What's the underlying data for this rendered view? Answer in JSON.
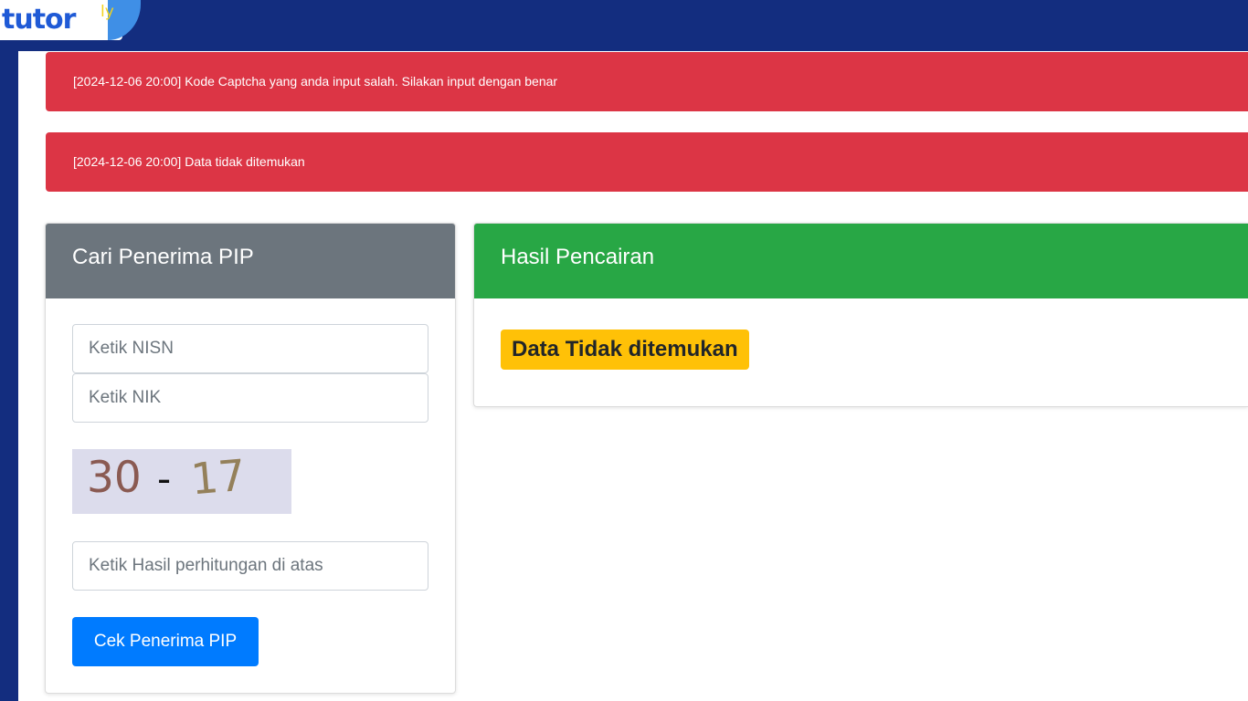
{
  "brand": {
    "logo_text": "tutor",
    "logo_sup": "ly",
    "accent": "#132d7f"
  },
  "alerts": [
    {
      "text": "[2024-12-06 20:00] Kode Captcha yang anda input salah. Silakan input dengan benar",
      "color": "#dc3545"
    },
    {
      "text": "[2024-12-06 20:00] Data tidak ditemukan",
      "color": "#dc3545"
    }
  ],
  "search": {
    "title": "Cari Penerima PIP",
    "nisn_placeholder": "Ketik NISN",
    "nisn_value": "",
    "nik_placeholder": "Ketik NIK",
    "nik_value": "",
    "captcha_a": "30",
    "captcha_op": "-",
    "captcha_b": "17",
    "answer_placeholder": "Ketik Hasil perhitungan di atas",
    "answer_value": "",
    "submit_label": "Cek Penerima PIP"
  },
  "result": {
    "title": "Hasil Pencairan",
    "message": "Data Tidak ditemukan"
  }
}
